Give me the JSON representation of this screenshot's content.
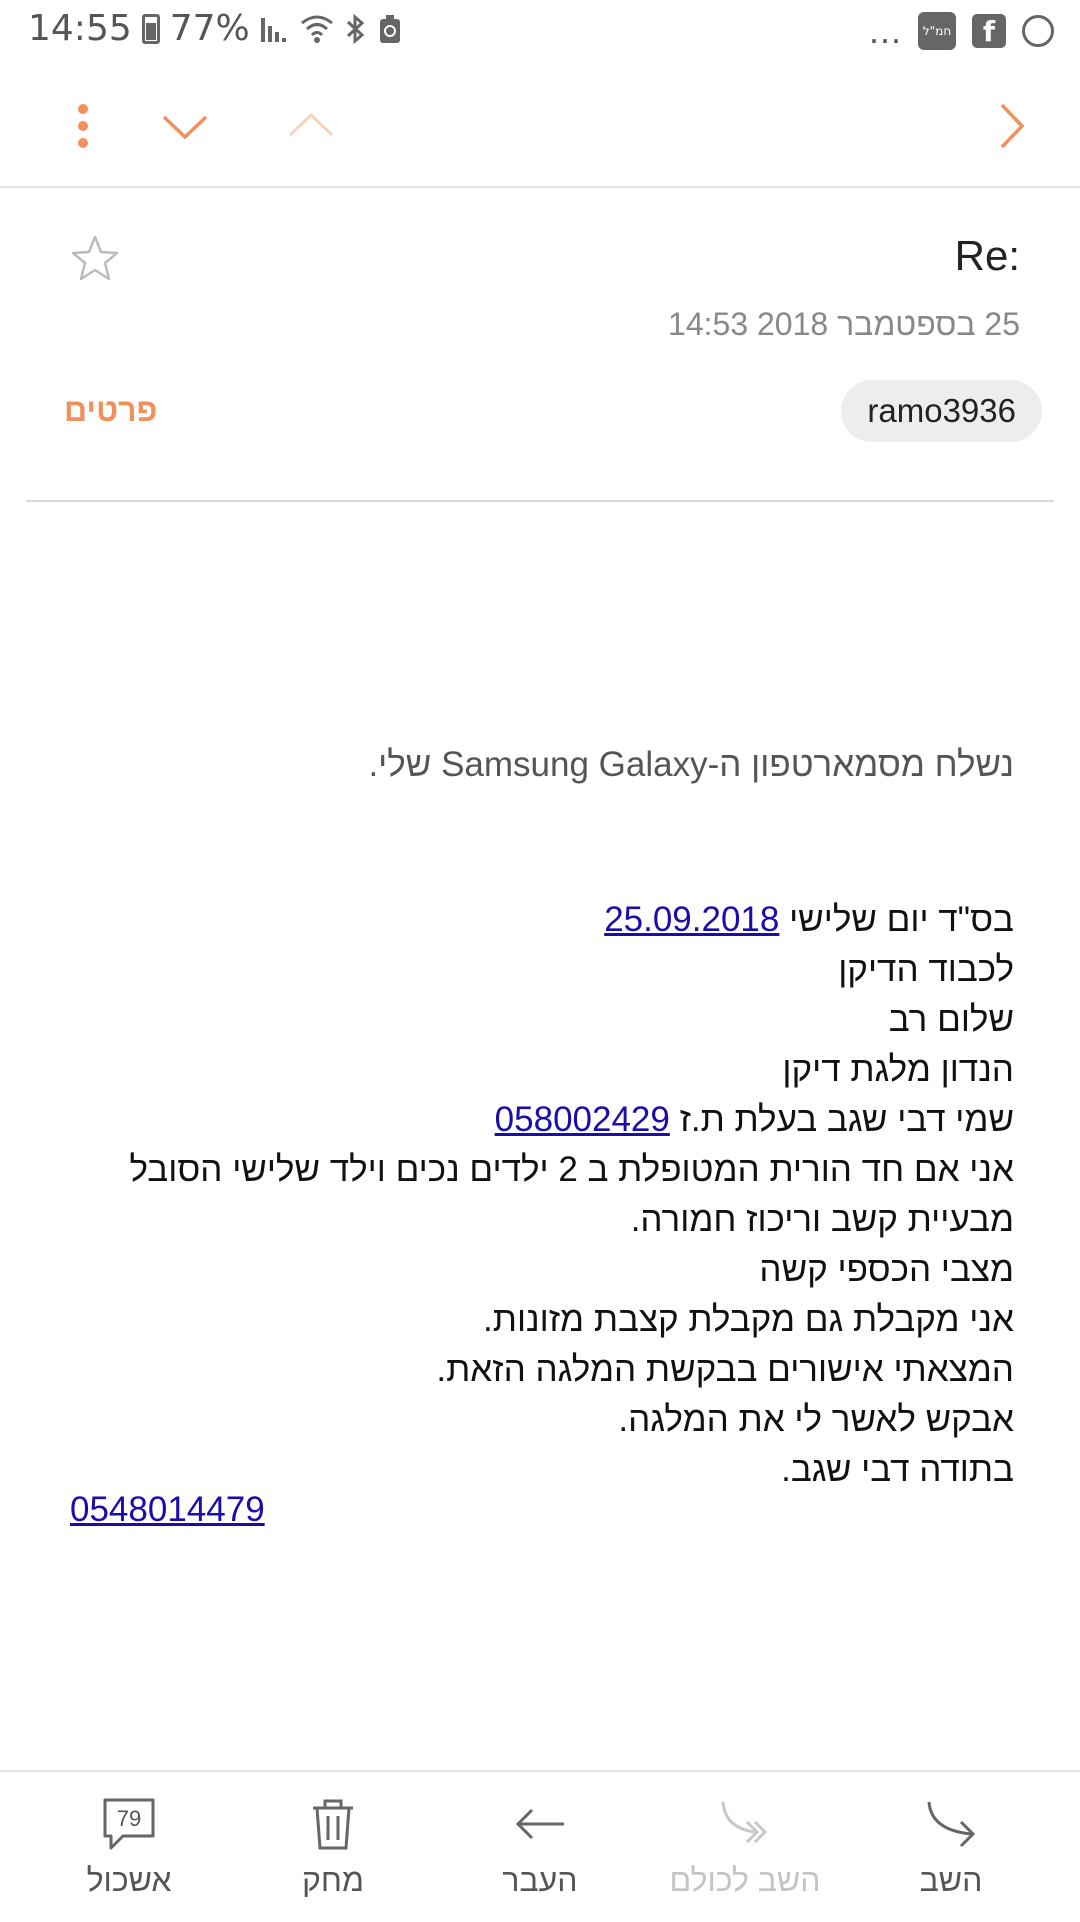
{
  "status_bar": {
    "time": "14:55",
    "battery": "77%",
    "more": "...",
    "app_badge": "חמ\"ל",
    "fb": "f"
  },
  "toolbar": {
    "accent_color": "#f0915c",
    "icons": [
      "more-vert-icon",
      "chevron-down-icon",
      "chevron-up-icon",
      "chevron-right-icon"
    ]
  },
  "email": {
    "subject": "Re:",
    "date": "25 בספטמבר 2018  14:53",
    "sender": "ramo3936",
    "details_label": "פרטים",
    "signature": "נשלח מסמארטפון ה-Samsung Galaxy שלי."
  },
  "letter": {
    "line1_prefix": "בס\"ד יום שלישי ",
    "line1_date": "25.09.2018",
    "line2": "לכבוד הדיקן",
    "line3": "שלום רב",
    "line4": "הנדון מלגת דיקן",
    "line5_prefix": "שמי דבי שגב בעלת ת.ז ",
    "line5_id": "058002429",
    "line6": "אני אם חד הורית המטופלת ב 2 ילדים נכים וילד שלישי הסובל",
    "line7": "מבעיית קשב וריכוז חמורה.",
    "line8": "מצבי הכספי קשה",
    "line9": "אני מקבלת גם מקבלת קצבת מזונות.",
    "line10": "המצאתי אישורים בבקשת המלגה הזאת.",
    "line11": "אבקש לאשר לי את המלגה.",
    "line12": "בתודה דבי שגב.",
    "phone": "0548014479"
  },
  "bottom_bar": {
    "reply": "השב",
    "reply_all": "השב לכולם",
    "forward": "העבר",
    "delete": "מחק",
    "cluster": "אשכול",
    "cluster_count": "79"
  }
}
